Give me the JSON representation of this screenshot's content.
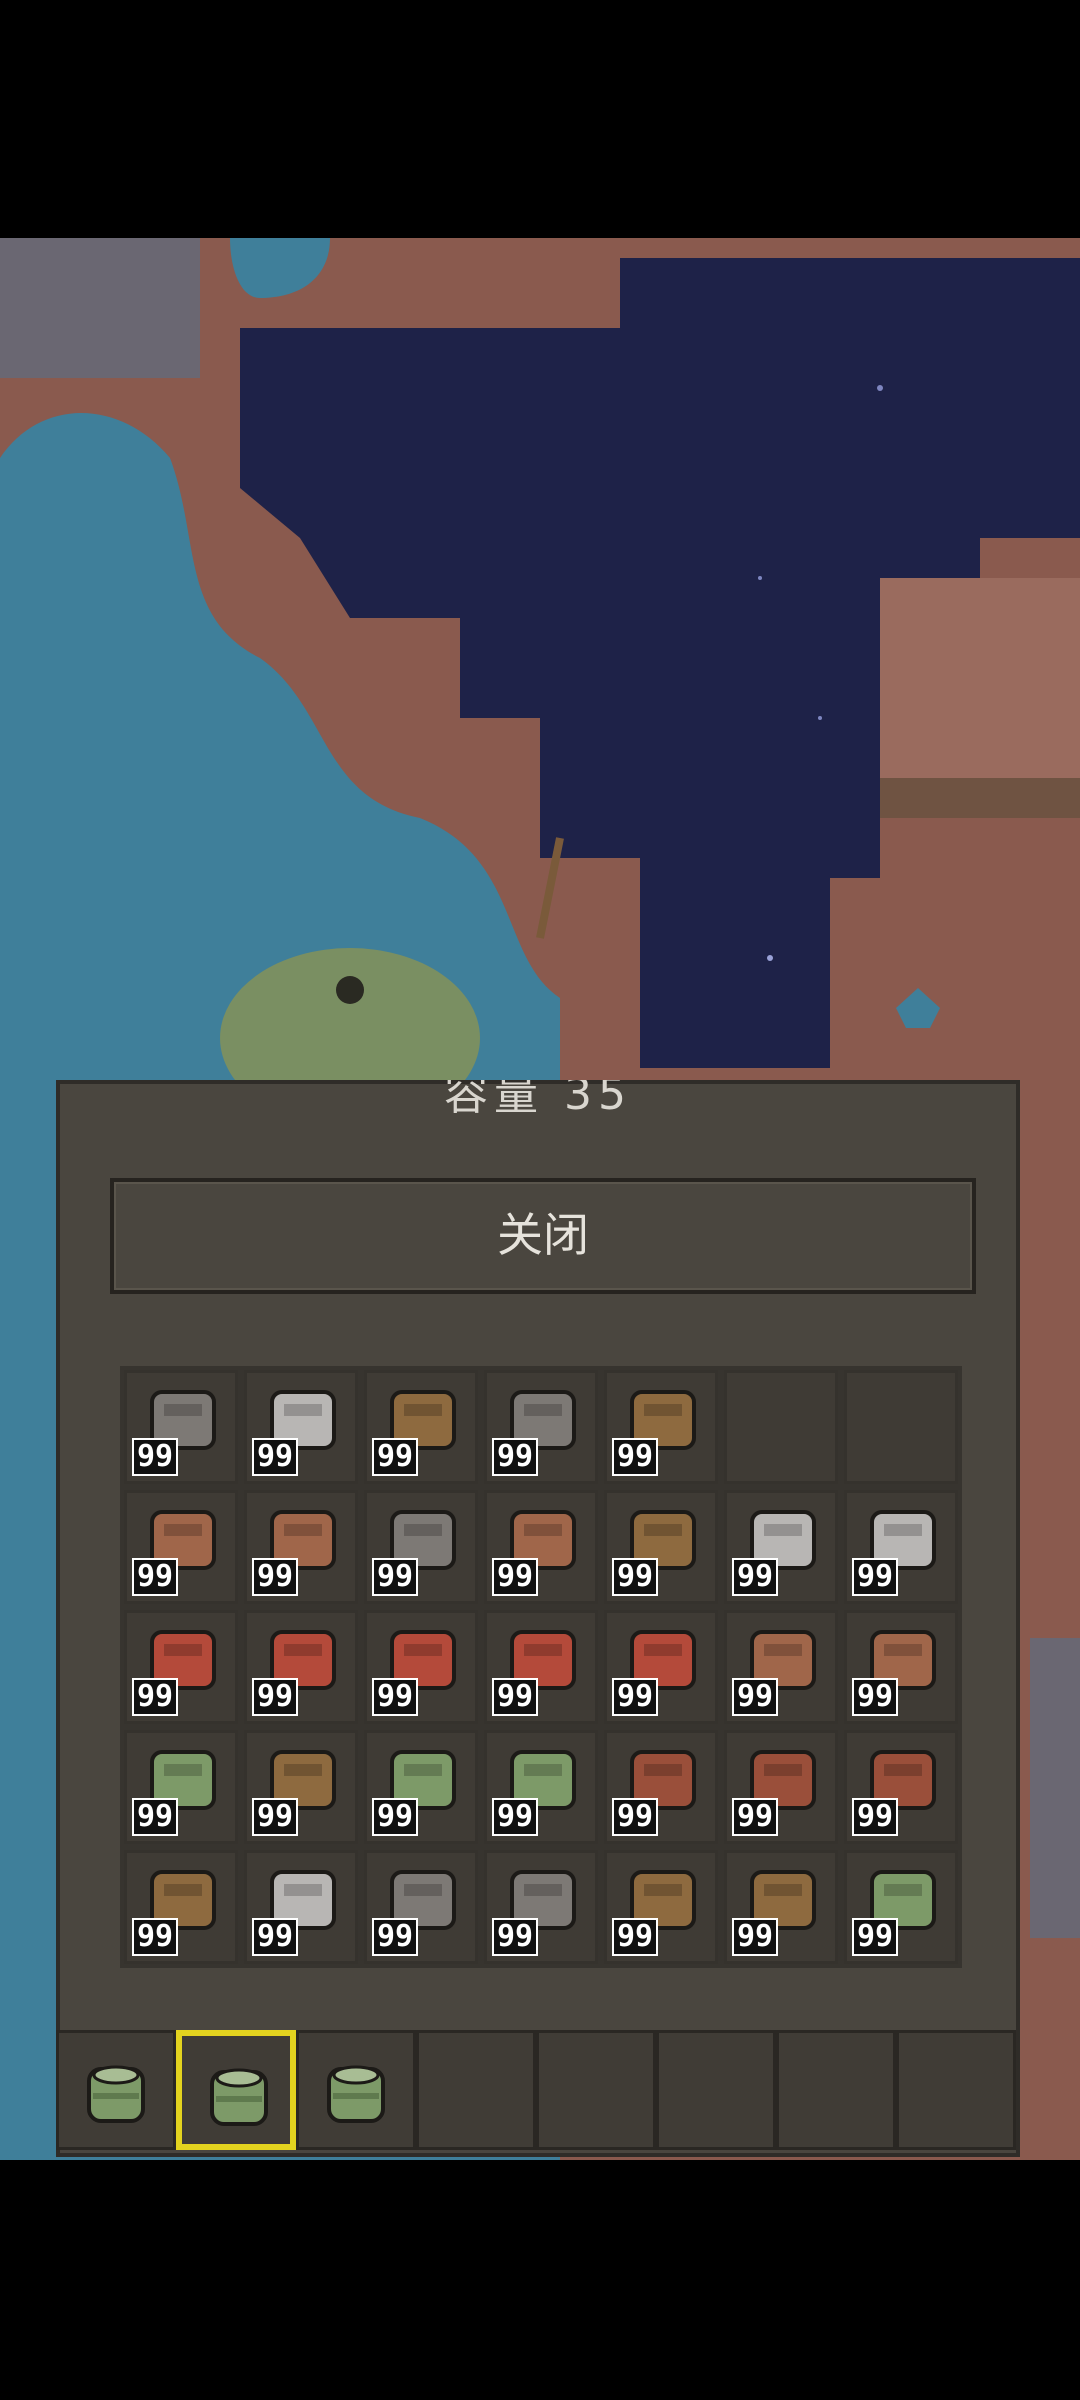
{
  "panel": {
    "title": "容量 35",
    "close_label": "关闭"
  },
  "inventory": {
    "rows": [
      [
        {
          "icon": "iron-furnace-icon",
          "count": "99"
        },
        {
          "icon": "washing-machine-icon",
          "count": "99"
        },
        {
          "icon": "workbench-icon",
          "count": "99"
        },
        {
          "icon": "rock-pile-icon",
          "count": "99"
        },
        {
          "icon": "wooden-door-icon",
          "count": "99"
        },
        {
          "icon": "empty",
          "count": ""
        },
        {
          "icon": "empty",
          "count": ""
        }
      ],
      [
        {
          "icon": "clay-kiln-icon",
          "count": "99"
        },
        {
          "icon": "clay-pot-stack-icon",
          "count": "99"
        },
        {
          "icon": "stone-oven-icon",
          "count": "99"
        },
        {
          "icon": "clay-jar-icon",
          "count": "99"
        },
        {
          "icon": "scarecrow-icon",
          "count": "99"
        },
        {
          "icon": "metal-machine-icon",
          "count": "99"
        },
        {
          "icon": "crystal-icon",
          "count": "99"
        }
      ],
      [
        {
          "icon": "brick-house-icon",
          "count": "99"
        },
        {
          "icon": "small-red-house-icon",
          "count": "99"
        },
        {
          "icon": "red-roof-house-icon",
          "count": "99"
        },
        {
          "icon": "red-roof-house-2-icon",
          "count": "99"
        },
        {
          "icon": "red-hut-icon",
          "count": "99"
        },
        {
          "icon": "clay-basin-icon",
          "count": "99"
        },
        {
          "icon": "clay-dome-icon",
          "count": "99"
        }
      ],
      [
        {
          "icon": "leaf-hut-icon",
          "count": "99"
        },
        {
          "icon": "storage-chest-icon",
          "count": "99"
        },
        {
          "icon": "thatched-hut-icon",
          "count": "99"
        },
        {
          "icon": "green-tent-icon",
          "count": "99"
        },
        {
          "icon": "brick-mansion-icon",
          "count": "99"
        },
        {
          "icon": "lit-tower-icon",
          "count": "99"
        },
        {
          "icon": "brick-tower-icon",
          "count": "99"
        }
      ],
      [
        {
          "icon": "shovel-icon",
          "count": "99"
        },
        {
          "icon": "axe-icon",
          "count": "99"
        },
        {
          "icon": "tool-rack-icon",
          "count": "99"
        },
        {
          "icon": "coil-icon",
          "count": "99"
        },
        {
          "icon": "tent-door-icon",
          "count": "99"
        },
        {
          "icon": "wooden-tent-icon",
          "count": "99"
        },
        {
          "icon": "dome-hut-icon",
          "count": "99"
        }
      ]
    ]
  },
  "hotbar": {
    "selected_index": 1,
    "slots": [
      {
        "icon": "green-pot-icon"
      },
      {
        "icon": "green-pot-icon"
      },
      {
        "icon": "green-pot-icon"
      },
      {
        "icon": "empty"
      },
      {
        "icon": "empty"
      },
      {
        "icon": "empty"
      },
      {
        "icon": "empty"
      },
      {
        "icon": "empty"
      }
    ]
  },
  "colors": {
    "selection": "#e3d31f",
    "panel": "#4a463f",
    "water": "#3f7f9a",
    "dirt": "#8a5a4e",
    "night_sky": "#1e2248"
  }
}
